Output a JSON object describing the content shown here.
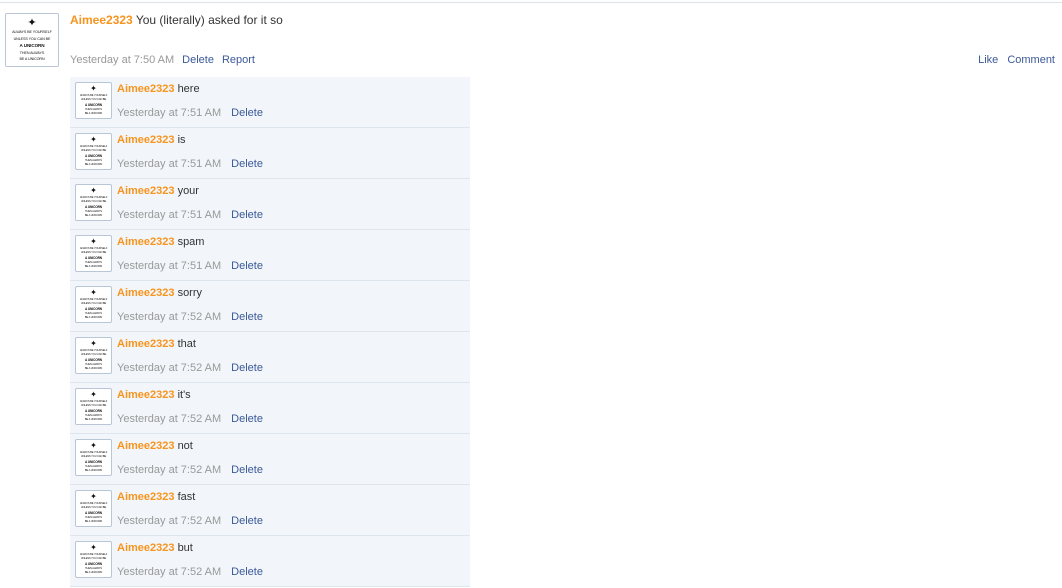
{
  "avatar": {
    "line1": "ALWAYS BE YOURSELF",
    "line2": "UNLESS YOU CAN BE",
    "line3": "A UNICORN",
    "line4": "THEN ALWAYS",
    "line5": "BE A UNICORN"
  },
  "icons": {
    "unicorn": "unicorn-silhouette-icon"
  },
  "colors": {
    "username": "#f7941d",
    "link": "#3b5998",
    "timestamp": "#999999",
    "reply_background": "#f2f6fa"
  },
  "main_comment": {
    "username": "Aimee2323",
    "text": "You (literally) asked for it so",
    "timestamp": "Yesterday at 7:50 AM",
    "delete_label": "Delete",
    "report_label": "Report",
    "like_label": "Like",
    "comment_label": "Comment"
  },
  "replies": [
    {
      "username": "Aimee2323",
      "text": "here",
      "timestamp": "Yesterday at 7:51 AM",
      "delete_label": "Delete"
    },
    {
      "username": "Aimee2323",
      "text": "is",
      "timestamp": "Yesterday at 7:51 AM",
      "delete_label": "Delete"
    },
    {
      "username": "Aimee2323",
      "text": "your",
      "timestamp": "Yesterday at 7:51 AM",
      "delete_label": "Delete"
    },
    {
      "username": "Aimee2323",
      "text": "spam",
      "timestamp": "Yesterday at 7:51 AM",
      "delete_label": "Delete"
    },
    {
      "username": "Aimee2323",
      "text": "sorry",
      "timestamp": "Yesterday at 7:52 AM",
      "delete_label": "Delete"
    },
    {
      "username": "Aimee2323",
      "text": "that",
      "timestamp": "Yesterday at 7:52 AM",
      "delete_label": "Delete"
    },
    {
      "username": "Aimee2323",
      "text": "it's",
      "timestamp": "Yesterday at 7:52 AM",
      "delete_label": "Delete"
    },
    {
      "username": "Aimee2323",
      "text": "not",
      "timestamp": "Yesterday at 7:52 AM",
      "delete_label": "Delete"
    },
    {
      "username": "Aimee2323",
      "text": "fast",
      "timestamp": "Yesterday at 7:52 AM",
      "delete_label": "Delete"
    },
    {
      "username": "Aimee2323",
      "text": "but",
      "timestamp": "Yesterday at 7:52 AM",
      "delete_label": "Delete"
    }
  ]
}
